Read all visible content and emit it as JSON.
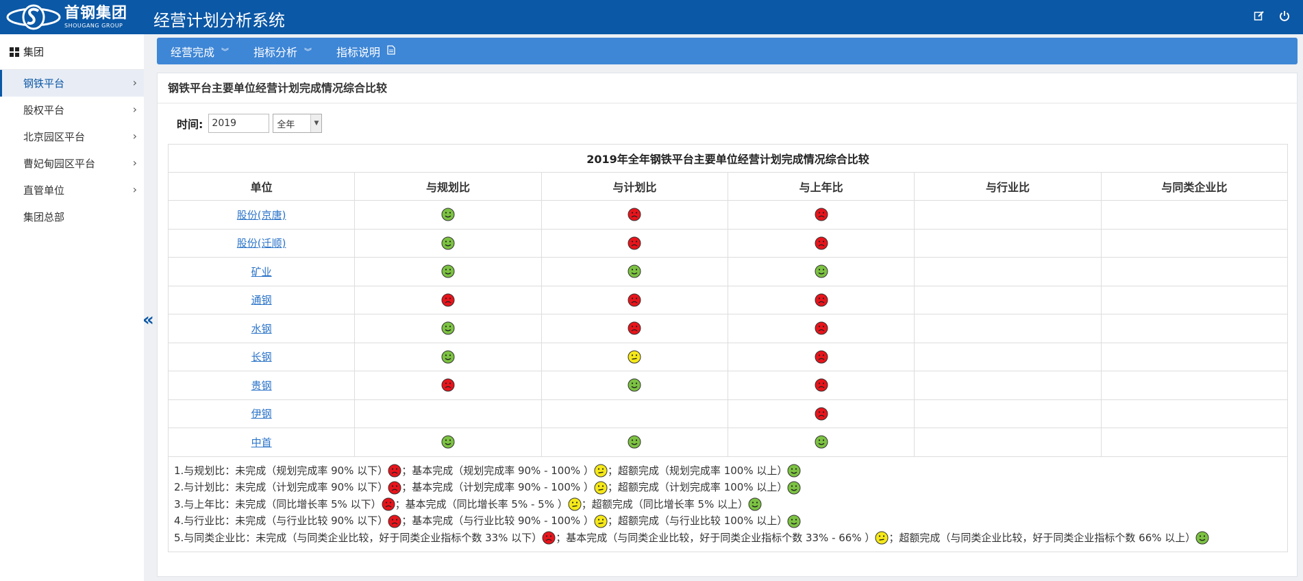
{
  "header": {
    "logo_cn": "首钢集团",
    "logo_en": "SHOUGANG GROUP",
    "title": "经营计划分析系统",
    "icons": [
      "edit-icon",
      "power-icon"
    ]
  },
  "sidebar": {
    "group_label": "集团",
    "items": [
      {
        "label": "钢铁平台",
        "active": true,
        "has_children": true
      },
      {
        "label": "股权平台",
        "has_children": true
      },
      {
        "label": "北京园区平台",
        "has_children": true
      },
      {
        "label": "曹妃甸园区平台",
        "has_children": true
      },
      {
        "label": "直管单位",
        "has_children": true
      },
      {
        "label": "集团总部",
        "has_children": false
      }
    ]
  },
  "topnav": {
    "items": [
      {
        "label": "经营完成",
        "icon": "chevron-double-down-icon"
      },
      {
        "label": "指标分析",
        "icon": "chevron-double-down-icon"
      },
      {
        "label": "指标说明",
        "icon": "document-icon"
      }
    ]
  },
  "panel": {
    "title": "钢铁平台主要单位经营计划完成情况综合比较",
    "filter": {
      "label": "时间:",
      "year": "2019",
      "period": "全年"
    }
  },
  "table": {
    "caption": "2019年全年钢铁平台主要单位经营计划完成情况综合比较",
    "headers": [
      "单位",
      "与规划比",
      "与计划比",
      "与上年比",
      "与行业比",
      "与同类企业比"
    ],
    "rows": [
      {
        "unit": "股份(京唐)",
        "marks": [
          "green",
          "red",
          "red",
          "",
          ""
        ]
      },
      {
        "unit": "股份(迁顺)",
        "marks": [
          "green",
          "red",
          "red",
          "",
          ""
        ]
      },
      {
        "unit": "矿业",
        "marks": [
          "green",
          "green",
          "green",
          "",
          ""
        ]
      },
      {
        "unit": "通钢",
        "marks": [
          "red",
          "red",
          "red",
          "",
          ""
        ]
      },
      {
        "unit": "水钢",
        "marks": [
          "green",
          "red",
          "red",
          "",
          ""
        ]
      },
      {
        "unit": "长钢",
        "marks": [
          "green",
          "yellow",
          "red",
          "",
          ""
        ]
      },
      {
        "unit": "贵钢",
        "marks": [
          "red",
          "green",
          "red",
          "",
          ""
        ]
      },
      {
        "unit": "伊钢",
        "marks": [
          "",
          "",
          "red",
          "",
          ""
        ]
      },
      {
        "unit": "中首",
        "marks": [
          "green",
          "green",
          "green",
          "",
          ""
        ]
      }
    ],
    "legend": [
      [
        {
          "t": "1.与规划比：未完成（规划完成率 90% 以下）"
        },
        {
          "f": "red"
        },
        {
          "t": "；基本完成（规划完成率 90% - 100% ）"
        },
        {
          "f": "yellow"
        },
        {
          "t": "；超额完成（规划完成率 100% 以上）"
        },
        {
          "f": "green"
        }
      ],
      [
        {
          "t": "2.与计划比：未完成（计划完成率 90% 以下）"
        },
        {
          "f": "red"
        },
        {
          "t": "；基本完成（计划完成率 90% - 100% ）"
        },
        {
          "f": "yellow"
        },
        {
          "t": "；超额完成（计划完成率 100% 以上）"
        },
        {
          "f": "green"
        }
      ],
      [
        {
          "t": "3.与上年比：未完成（同比增长率 5% 以下）"
        },
        {
          "f": "red"
        },
        {
          "t": "；基本完成（同比增长率 5% - 5% ）"
        },
        {
          "f": "yellow"
        },
        {
          "t": "；超额完成（同比增长率 5% 以上）"
        },
        {
          "f": "green"
        }
      ],
      [
        {
          "t": "4.与行业比：未完成（与行业比较 90% 以下）"
        },
        {
          "f": "red"
        },
        {
          "t": "；基本完成（与行业比较 90% - 100% ）"
        },
        {
          "f": "yellow"
        },
        {
          "t": "；超额完成（与行业比较 100% 以上）"
        },
        {
          "f": "green"
        }
      ],
      [
        {
          "t": "5.与同类企业比：未完成（与同类企业比较，好于同类企业指标个数 33% 以下）"
        },
        {
          "f": "red"
        },
        {
          "t": "；基本完成（与同类企业比较，好于同类企业指标个数 33% - 66% ）"
        },
        {
          "f": "yellow"
        },
        {
          "t": "；超额完成（与同类企业比较，好于同类企业指标个数 66% 以上）"
        },
        {
          "f": "green"
        }
      ]
    ]
  },
  "colors": {
    "header_bg": "#0b58a6",
    "nav_bg": "#3e86d6",
    "face_red": "#e8141b",
    "face_yellow": "#f5e818",
    "face_green": "#7cc242"
  }
}
